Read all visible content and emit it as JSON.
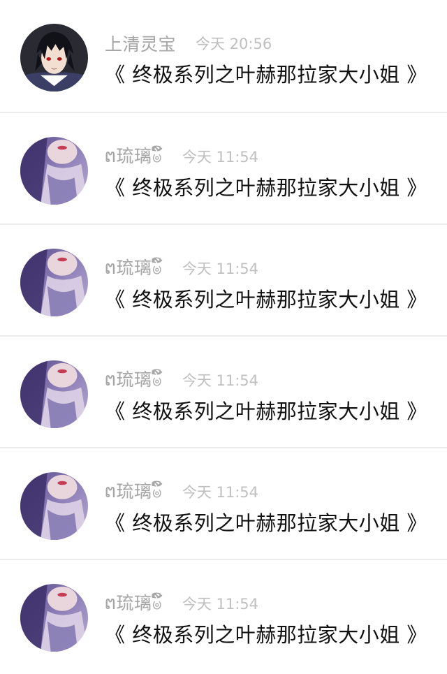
{
  "comments": [
    {
      "name": "上清灵宝",
      "time": "今天 20:56",
      "text": "《 终极系列之叶赫那拉家大小姐 》",
      "avatar": "anime-character-avatar"
    },
    {
      "name": "ຕ琉璃ၑ໌ິ",
      "time": "今天 11:54",
      "text": "《 终极系列之叶赫那拉家大小姐 》",
      "avatar": "girl-photo-avatar"
    },
    {
      "name": "ຕ琉璃ၑ໌ິ",
      "time": "今天 11:54",
      "text": "《 终极系列之叶赫那拉家大小姐 》",
      "avatar": "girl-photo-avatar"
    },
    {
      "name": "ຕ琉璃ၑ໌ິ",
      "time": "今天 11:54",
      "text": "《 终极系列之叶赫那拉家大小姐 》",
      "avatar": "girl-photo-avatar"
    },
    {
      "name": "ຕ琉璃ၑ໌ິ",
      "time": "今天 11:54",
      "text": "《 终极系列之叶赫那拉家大小姐 》",
      "avatar": "girl-photo-avatar"
    },
    {
      "name": "ຕ琉璃ၑ໌ິ",
      "time": "今天 11:54",
      "text": "《 终极系列之叶赫那拉家大小姐 》",
      "avatar": "girl-photo-avatar"
    }
  ],
  "colors": {
    "name": "#a6a6a6",
    "time": "#bfbfbf",
    "text": "#111111",
    "divider": "#ececec"
  }
}
